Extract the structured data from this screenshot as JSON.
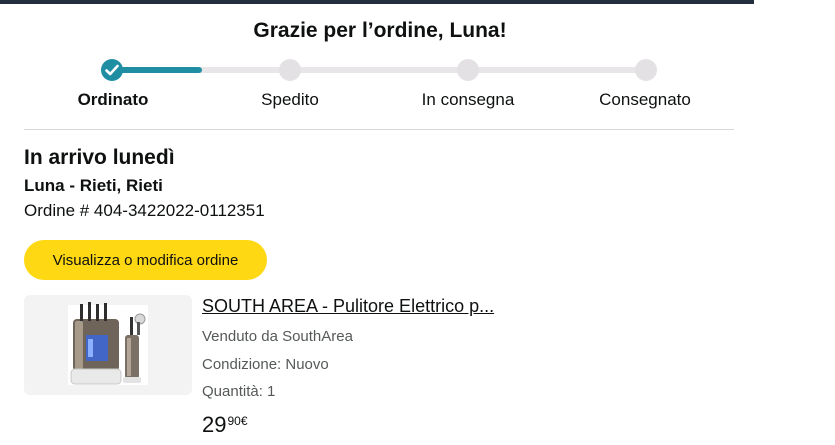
{
  "page": {
    "title": "Grazie per l’ordine, Luna!"
  },
  "progress": {
    "steps": [
      "Ordinato",
      "Spedito",
      "In consegna",
      "Consegnato"
    ],
    "current_step": 1
  },
  "delivery": {
    "arrival": "In arrivo lunedì",
    "address": "Luna - Rieti, Rieti",
    "order_number": "Ordine # 404-3422022-0112351"
  },
  "actions": {
    "view_edit_label": "Visualizza o modifica ordine"
  },
  "product": {
    "title": "SOUTH AREA - Pulitore Elettrico p...",
    "seller": "Venduto da SouthArea",
    "condition": "Condizione: Nuovo",
    "quantity": "Quantità: 1",
    "price_whole": "29",
    "price_fraction": "90€"
  },
  "colors": {
    "accent": "#1f8ea3",
    "button": "#ffd814",
    "top_bar": "#232f3e"
  }
}
